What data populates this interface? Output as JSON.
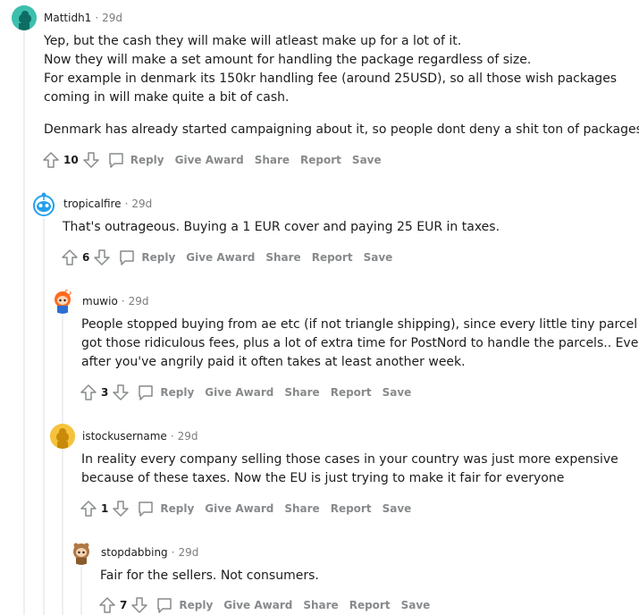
{
  "comments": [
    {
      "author": "Mattidh1",
      "separator": "·",
      "time": "29d",
      "body": [
        "Yep, but the cash they will make will atleast make up for a lot of it.",
        "Now they will make a set amount for handling the package regardless of size.",
        "For example in denmark its 150kr handling fee (around 25USD), so all those wish packages",
        "coming in will make quite a bit of cash.",
        "Denmark has already started campaigning about it, so people dont deny a shit ton of packages."
      ],
      "score": "10",
      "actions": [
        "Reply",
        "Give Award",
        "Share",
        "Report",
        "Save"
      ]
    },
    {
      "author": "tropicalfire",
      "separator": "·",
      "time": "29d",
      "body": [
        "That's outrageous. Buying a 1 EUR cover and paying 25 EUR in taxes."
      ],
      "score": "6",
      "actions": [
        "Reply",
        "Give Award",
        "Share",
        "Report",
        "Save"
      ]
    },
    {
      "author": "muwio",
      "separator": "·",
      "time": "29d",
      "body": [
        "People stopped buying from ae etc (if not triangle shipping), since every little tiny parcel",
        "got those ridiculous fees, plus a lot of extra time for PostNord to handle the parcels.. Even",
        "after you've angrily paid it often takes at least another week."
      ],
      "score": "3",
      "actions": [
        "Reply",
        "Give Award",
        "Share",
        "Report",
        "Save"
      ]
    },
    {
      "author": "istockusername",
      "separator": "·",
      "time": "29d",
      "body": [
        "In reality every company selling those cases in your country was just more expensive",
        "because of these taxes. Now the EU is just trying to make it fair for everyone"
      ],
      "score": "1",
      "actions": [
        "Reply",
        "Give Award",
        "Share",
        "Report",
        "Save"
      ]
    },
    {
      "author": "stopdabbing",
      "separator": "·",
      "time": "29d",
      "body": [
        "Fair for the sellers. Not consumers."
      ],
      "score": "7",
      "actions": [
        "Reply",
        "Give Award",
        "Share",
        "Report",
        "Save"
      ]
    }
  ],
  "icons": {
    "upvote": "arrow-up-outline-icon",
    "downvote": "arrow-down-outline-icon",
    "reply": "speech-bubble-icon"
  },
  "colors": {
    "meta": "#7c7c7c",
    "action": "#878a8c",
    "thread_line": "#edeff1",
    "text": "#1c1c1c"
  }
}
